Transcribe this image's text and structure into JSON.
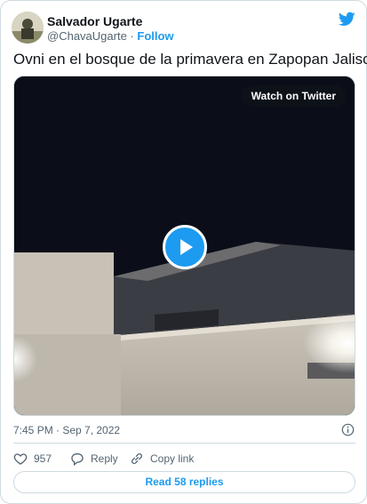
{
  "author": {
    "name": "Salvador Ugarte",
    "handle": "@ChavaUgarte",
    "separator": "·",
    "follow_label": "Follow"
  },
  "tweet": {
    "text": "Ovni en el bosque de la primavera en Zapopan Jalisco.",
    "timestamp": "7:45 PM · Sep 7, 2022"
  },
  "media": {
    "watch_label": "Watch on Twitter"
  },
  "actions": {
    "likes": "957",
    "reply_label": "Reply",
    "copy_link_label": "Copy link"
  },
  "footer": {
    "read_replies_label": "Read 58 replies"
  },
  "colors": {
    "accent": "#1d9bf0",
    "muted": "#536471",
    "border": "#cfd9de"
  }
}
